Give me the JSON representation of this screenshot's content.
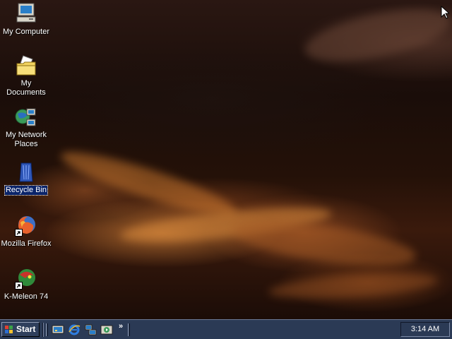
{
  "desktop": {
    "icons": [
      {
        "label": "My Computer"
      },
      {
        "label": "My Documents"
      },
      {
        "label": "My Network Places"
      },
      {
        "label": "Recycle Bin"
      },
      {
        "label": "Mozilla Firefox"
      },
      {
        "label": "K-Meleon 74"
      }
    ],
    "selected_icon": "Recycle Bin"
  },
  "taskbar": {
    "start_label": "Start",
    "quick_launch_more": "»",
    "clock": "3:14 AM",
    "quick_launch_icons": [
      "show-desktop-icon",
      "internet-explorer-icon",
      "network-icon",
      "media-icon"
    ]
  }
}
